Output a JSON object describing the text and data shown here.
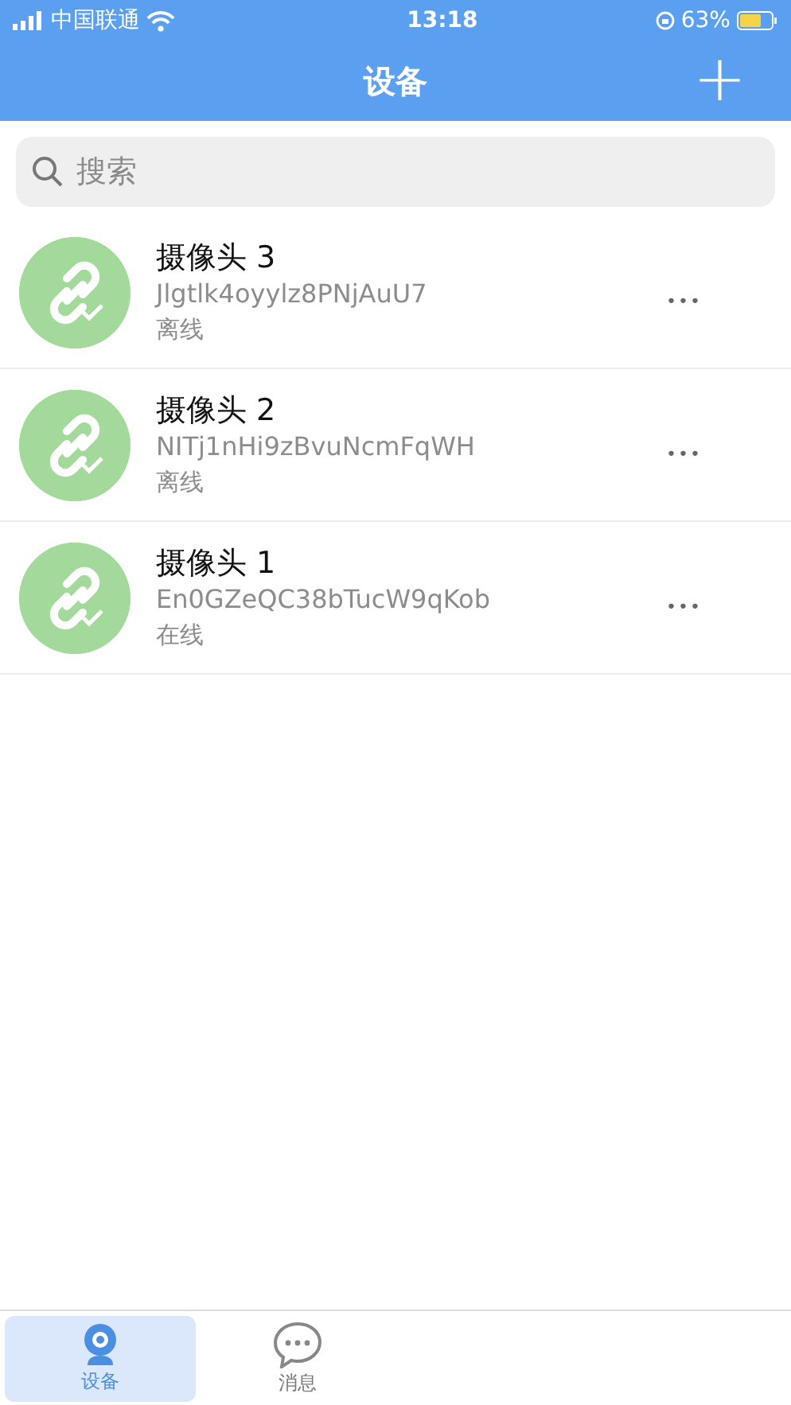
{
  "status_bar": {
    "carrier": "中国联通",
    "time": "13:18",
    "battery": "63%"
  },
  "header": {
    "title": "设备",
    "add_label": "+"
  },
  "search": {
    "placeholder": "搜索"
  },
  "devices": [
    {
      "name": "摄像头 3",
      "id": "Jlgtlk4oyylz8PNjAuU7",
      "status": "离线",
      "more": "•••"
    },
    {
      "name": "摄像头 2",
      "id": "NITj1nHi9zBvuNcmFqWH",
      "status": "离线",
      "more": "•••"
    },
    {
      "name": "摄像头 1",
      "id": "En0GZeQC38bTucW9qKob",
      "status": "在线",
      "more": "•••"
    }
  ],
  "tabs": [
    {
      "label": "设备",
      "selected": true,
      "kind": "camera"
    },
    {
      "label": "消息",
      "selected": false,
      "kind": "chat"
    }
  ]
}
